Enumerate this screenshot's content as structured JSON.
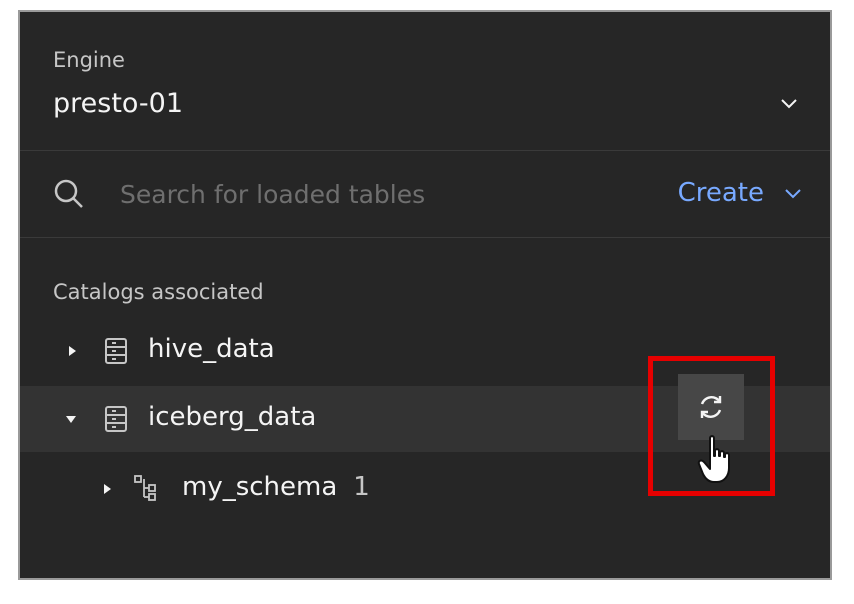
{
  "engine": {
    "label": "Engine",
    "value": "presto-01"
  },
  "search": {
    "placeholder": "Search for loaded tables"
  },
  "create_button": {
    "label": "Create"
  },
  "catalogs": {
    "section_label": "Catalogs associated",
    "items": [
      {
        "name": "hive_data",
        "expanded": false
      },
      {
        "name": "iceberg_data",
        "expanded": true,
        "selected": true
      }
    ],
    "schemas": [
      {
        "name": "my_schema",
        "count": "1"
      }
    ]
  },
  "icons": {
    "engine_dropdown": "chevron-down-icon",
    "search": "search-icon",
    "create_dropdown": "chevron-down-icon",
    "catalog": "catalog-icon",
    "schema": "schema-icon",
    "refresh": "refresh-icon",
    "cursor": "hand-pointer-cursor"
  },
  "colors": {
    "panel_background": "#262626",
    "accent_link": "#78a9ff",
    "highlight": "#e60000",
    "selected_row": "#333333"
  }
}
